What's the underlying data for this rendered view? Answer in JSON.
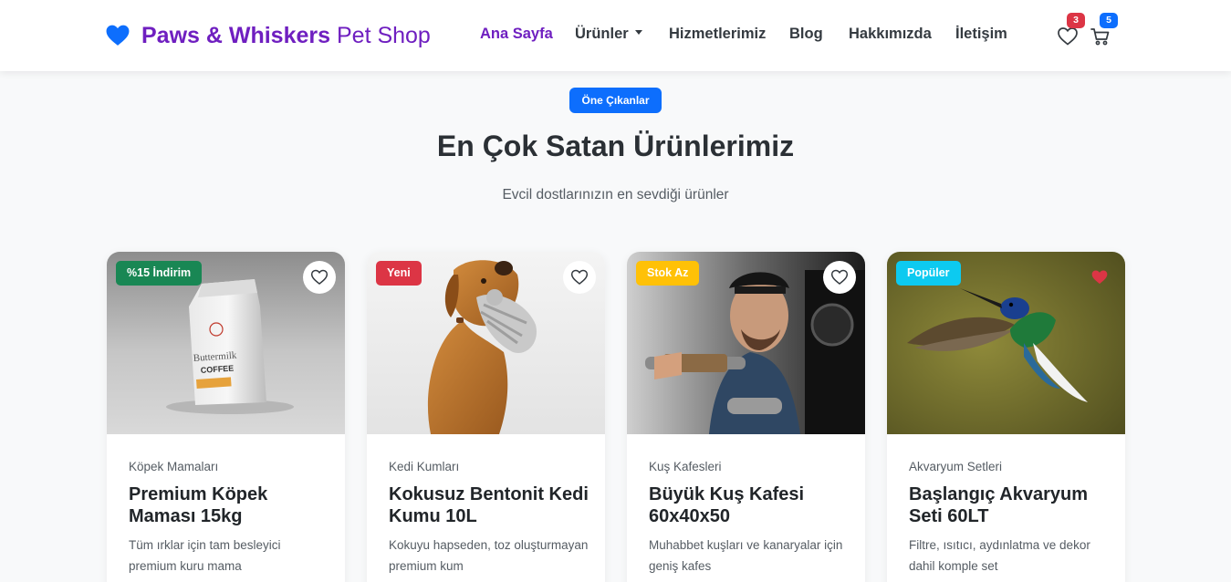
{
  "brand": {
    "name_bold": "Paws & Whiskers",
    "name_light": "Pet Shop",
    "icon": "heart-icon",
    "color": "#6f1fc0"
  },
  "nav": {
    "items": [
      {
        "label": "Ana Sayfa",
        "active": true
      },
      {
        "label": "Ürünler",
        "dropdown": true
      },
      {
        "label": "Hizmetlerimiz"
      },
      {
        "label": "Blog"
      },
      {
        "label": "Hakkımızda"
      },
      {
        "label": "İletişim"
      }
    ],
    "wishlist": {
      "icon": "heart-outline-icon",
      "count": "3"
    },
    "cart": {
      "icon": "cart-icon",
      "count": "5"
    }
  },
  "section": {
    "pill": "Öne Çıkanlar",
    "title": "En Çok Satan Ürünlerimiz",
    "subtitle": "Evcil dostlarınızın en sevdiği ürünler"
  },
  "products": [
    {
      "badge": "%15 İndirim",
      "badge_color": "#198754",
      "favorited": false,
      "image": "coffee-bag-photo",
      "category": "Köpek Mamaları",
      "title": "Premium Köpek Maması 15kg",
      "description": "Tüm ırklar için tam besleyici premium kuru mama"
    },
    {
      "badge": "Yeni",
      "badge_color": "#dc3545",
      "favorited": false,
      "image": "dog-with-toy-photo",
      "category": "Kedi Kumları",
      "title": "Kokusuz Bentonit Kedi Kumu 10L",
      "description": "Kokuyu hapseden, toz oluşturmayan premium kum"
    },
    {
      "badge": "Stok Az",
      "badge_color": "#ffc107",
      "favorited": false,
      "image": "coffee-roaster-man-photo",
      "category": "Kuş Kafesleri",
      "title": "Büyük Kuş Kafesi 60x40x50",
      "description": "Muhabbet kuşları ve kanaryalar için geniş kafes"
    },
    {
      "badge": "Popüler",
      "badge_color": "#0dcaf0",
      "favorited": true,
      "image": "hummingbird-photo",
      "category": "Akvaryum Setleri",
      "title": "Başlangıç Akvaryum Seti 60LT",
      "description": "Filtre, ısıtıcı, aydınlatma ve dekor dahil komple set"
    }
  ]
}
